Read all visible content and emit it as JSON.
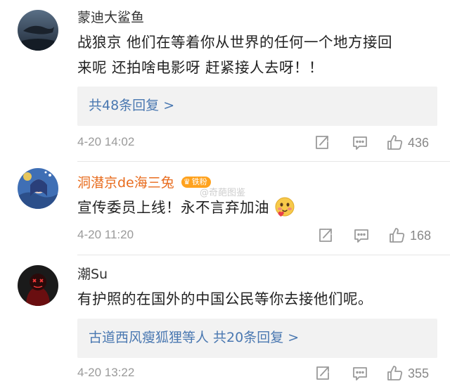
{
  "comments": [
    {
      "username": "蒙迪大鲨鱼",
      "text_line1": "战狼京 他们在等着你从世界的任何一个地方接回",
      "text_line2": "来呢 还拍啥电影呀 赶紧接人去呀！！",
      "reply_summary": "共48条回复 >",
      "time": "4-20 14:02",
      "likes": "436"
    },
    {
      "username": "洞潜京de海三兔",
      "badge": "铁粉",
      "text": "宣传委员上线！永不言弃加油",
      "time": "4-20 11:20",
      "likes": "168"
    },
    {
      "username": "潮Su",
      "text": "有护照的在国外的中国公民等你去接他们呢。",
      "reply_summary": "古道西风瘦狐狸等人 共20条回复 >",
      "time": "4-20 13:22",
      "likes": "355"
    }
  ],
  "watermark": "@奇葩图鉴",
  "icons": {
    "share": "share-icon",
    "comment": "comment-icon",
    "like": "like-icon",
    "badge": "crown-icon",
    "emoji": "blush-emoji"
  },
  "colors": {
    "link": "#4a78b1",
    "vip_name": "#e86c1e",
    "badge_bg": "#ffa21d",
    "meta": "#9a9a9a",
    "reply_bg": "#f2f2f2"
  }
}
